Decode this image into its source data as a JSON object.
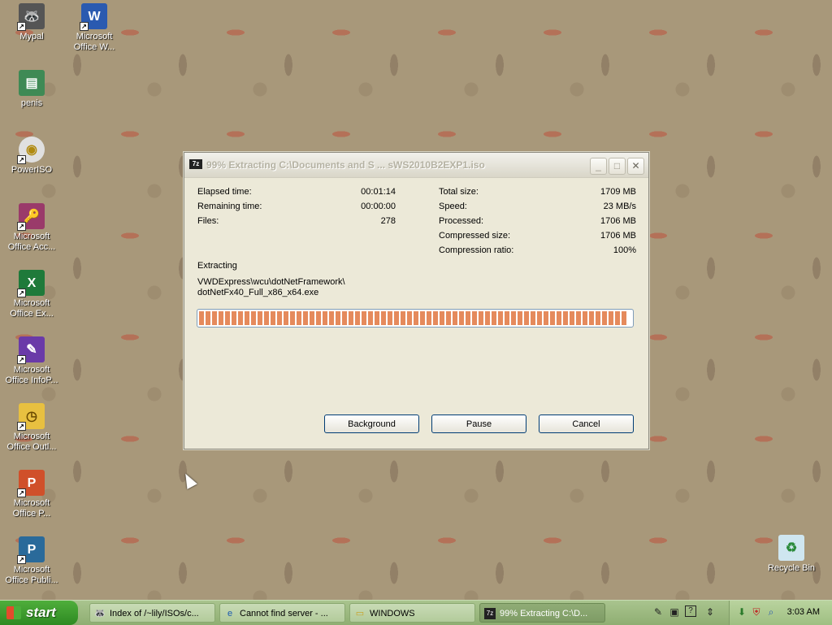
{
  "desktop": {
    "icons": [
      {
        "label": "Mypal"
      },
      {
        "label": "Microsoft Office W..."
      },
      {
        "label": "penis"
      },
      {
        "label": "PowerISO"
      },
      {
        "label": "Microsoft Office Acc..."
      },
      {
        "label": "Microsoft Office Ex..."
      },
      {
        "label": "Microsoft Office InfoP..."
      },
      {
        "label": "Microsoft Office Outl..."
      },
      {
        "label": "Microsoft Office P..."
      },
      {
        "label": "Microsoft Office Publi..."
      },
      {
        "label": "Recycle Bin"
      }
    ]
  },
  "dialog": {
    "app_icon": "7z",
    "title": "99% Extracting C:\\Documents and S ... sWS2010B2EXP1.iso",
    "left_stats": [
      {
        "label": "Elapsed time:",
        "value": "00:01:14"
      },
      {
        "label": "Remaining time:",
        "value": "00:00:00"
      },
      {
        "label": "Files:",
        "value": "278"
      }
    ],
    "right_stats": [
      {
        "label": "Total size:",
        "value": "1709 MB"
      },
      {
        "label": "Speed:",
        "value": "23 MB/s"
      },
      {
        "label": "Processed:",
        "value": "1706 MB"
      },
      {
        "label": "Compressed size:",
        "value": "1706 MB"
      },
      {
        "label": "Compression ratio:",
        "value": "100%"
      }
    ],
    "extracting_label": "Extracting",
    "current_path_line1": "VWDExpress\\wcu\\dotNetFramework\\",
    "current_path_line2": "dotNetFx40_Full_x86_x64.exe",
    "progress": 0.99,
    "buttons": {
      "background": "Background",
      "pause": "Pause",
      "cancel": "Cancel"
    }
  },
  "taskbar": {
    "start_label": "start",
    "tasks": [
      {
        "label": "Index of /~lily/ISOs/c...",
        "icon": "raccoon-icon"
      },
      {
        "label": "Cannot find server - ...",
        "icon": "ie-icon"
      },
      {
        "label": "WINDOWS",
        "icon": "folder-icon"
      },
      {
        "label": "99% Extracting C:\\D...",
        "icon": "7zip-icon",
        "active": true
      }
    ],
    "clock": "3:03 AM"
  },
  "colors": {
    "progress_fill": "#e58a5c",
    "taskbar": "#9fbf82",
    "start_button": "#3a9a2a",
    "dialog_bg": "#ece9d8"
  }
}
